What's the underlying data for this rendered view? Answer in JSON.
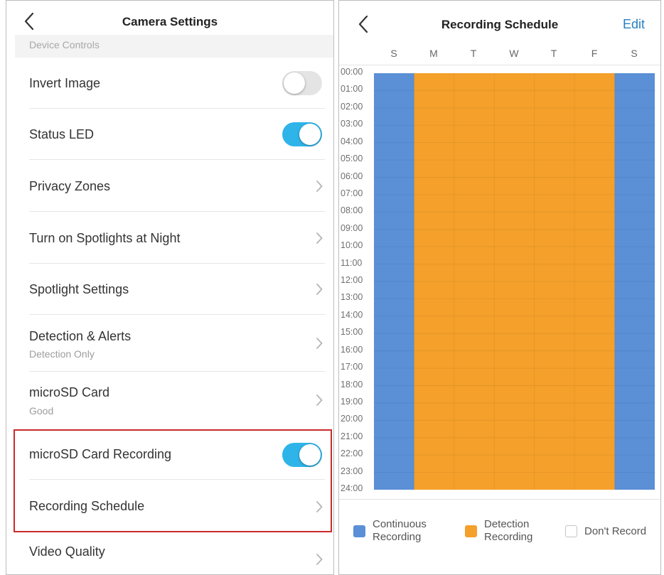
{
  "settings": {
    "title": "Camera Settings",
    "section": "Device Controls",
    "items": [
      {
        "label": "Invert Image",
        "control": "toggle",
        "on": false
      },
      {
        "label": "Status LED",
        "control": "toggle",
        "on": true
      },
      {
        "label": "Privacy Zones",
        "control": "chevron"
      },
      {
        "label": "Turn on Spotlights at Night",
        "control": "chevron"
      },
      {
        "label": "Spotlight Settings",
        "control": "chevron"
      },
      {
        "label": "Detection & Alerts",
        "sub": "Detection Only",
        "control": "chevron"
      },
      {
        "label": "microSD Card",
        "sub": "Good",
        "control": "chevron"
      },
      {
        "label": "microSD Card Recording",
        "control": "toggle",
        "on": true
      },
      {
        "label": "Recording Schedule",
        "control": "chevron"
      },
      {
        "label": "Video Quality",
        "control": "chevron"
      }
    ]
  },
  "schedule": {
    "title": "Recording Schedule",
    "edit_label": "Edit",
    "days": [
      "S",
      "M",
      "T",
      "W",
      "T",
      "F",
      "S"
    ],
    "hours": [
      "00:00",
      "01:00",
      "02:00",
      "03:00",
      "04:00",
      "05:00",
      "06:00",
      "07:00",
      "08:00",
      "09:00",
      "10:00",
      "11:00",
      "12:00",
      "13:00",
      "14:00",
      "15:00",
      "16:00",
      "17:00",
      "18:00",
      "19:00",
      "20:00",
      "21:00",
      "22:00",
      "23:00",
      "24:00"
    ],
    "day_modes": [
      "continuous",
      "detection",
      "detection",
      "detection",
      "detection",
      "detection",
      "continuous"
    ],
    "legend": {
      "continuous": {
        "line1": "Continuous",
        "line2": "Recording",
        "color": "#5b8fd6"
      },
      "detection": {
        "line1": "Detection",
        "line2": "Recording",
        "color": "#f4a02b"
      },
      "none": {
        "label": "Don't Record"
      }
    }
  },
  "colors": {
    "toggle_on": "#2fb4e9",
    "highlight": "#c92a2a",
    "edit": "#2680c2"
  }
}
